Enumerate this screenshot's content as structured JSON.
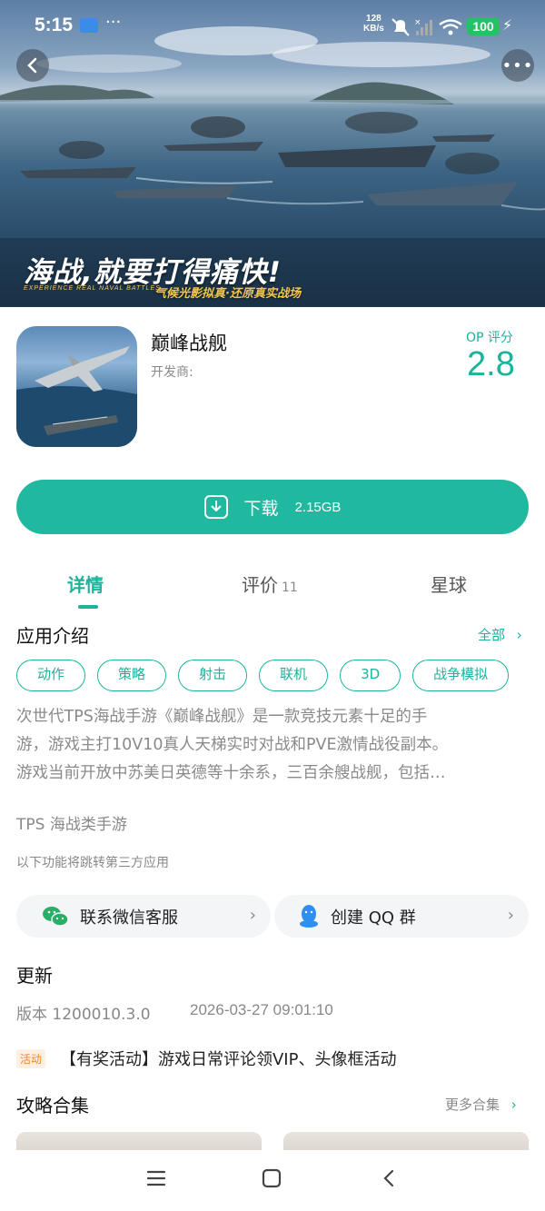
{
  "status_bar": {
    "time": "5:15",
    "dots": "···",
    "speed_value": "128",
    "speed_unit": "KB/s",
    "battery": "100",
    "icons": [
      "mail-icon",
      "mute-icon",
      "signal-icon",
      "wifi-icon",
      "charging-icon"
    ]
  },
  "hero": {
    "slogan": "海战,就要打得痛快!",
    "slogan_en": "EXPERIENCE REAL NAVAL BATTLES",
    "slogan_sub": "气候光影拟真·还原真实战场"
  },
  "app": {
    "name": "巅峰战舰",
    "developer_label": "开发商:",
    "rating_label": "OP 评分",
    "rating_value": "2.8"
  },
  "download": {
    "label": "下载",
    "size": "2.15GB"
  },
  "tabs": [
    {
      "label": "详情",
      "count": ""
    },
    {
      "label": "评价",
      "count": "11"
    },
    {
      "label": "星球",
      "count": ""
    }
  ],
  "intro": {
    "title": "应用介绍",
    "see_all": "全部",
    "tags": [
      "动作",
      "策略",
      "射击",
      "联机",
      "3D",
      "战争模拟"
    ],
    "description_lines": [
      "次世代TPS海战手游《巅峰战舰》是一款竞技元素十足的手",
      "游，游戏主打10V10真人天梯实时对战和PVE激情战役副本。",
      "游戏当前开放中苏美日英德等十余系，三百余艘战舰，包括…"
    ],
    "subtitle": "TPS 海战类手游",
    "third_party_note": "以下功能将跳转第三方应用"
  },
  "contacts": [
    {
      "label": "联系微信客服",
      "icon": "wechat-icon"
    },
    {
      "label": "创建 QQ 群",
      "icon": "qq-icon"
    }
  ],
  "update": {
    "title": "更新",
    "version": "版本 1200010.3.0",
    "date": "2026-03-27 09:01:10",
    "activity_badge": "活动",
    "activity_text": "【有奖活动】游戏日常评论领VIP、头像框活动"
  },
  "guides": {
    "title": "攻略合集",
    "more": "更多合集"
  },
  "colors": {
    "accent": "#1bb39b",
    "download_button": "#21b8a0",
    "battery": "#25c164",
    "activity_badge": "#e88a2a"
  }
}
